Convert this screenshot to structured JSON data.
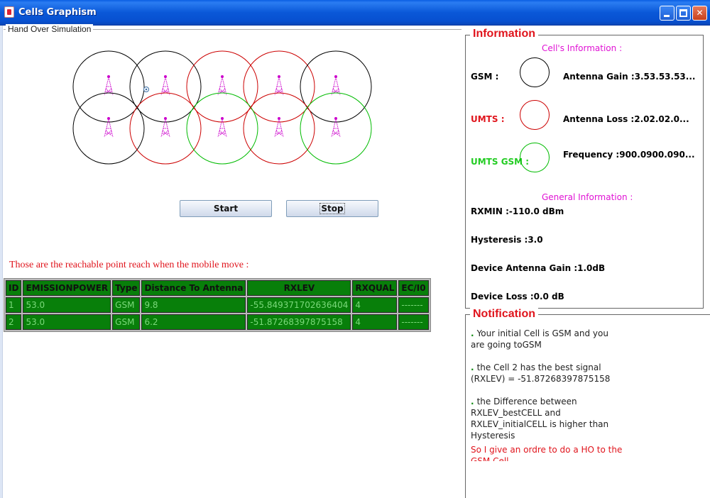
{
  "window": {
    "title": "Cells Graphism"
  },
  "simulation": {
    "panel_title": "Hand Over Simulation",
    "start_label": "Start",
    "stop_label": "Stop",
    "caption": "Those are the reachable point reach when the mobile move :"
  },
  "cells": {
    "colors": {
      "gsm": "#000000",
      "umts": "#cc0000",
      "umts_gsm": "#00bb00",
      "antenna": "#cc00cc",
      "mobile": "#3a6ea5"
    },
    "top_row": [
      "gsm",
      "gsm",
      "umts",
      "umts",
      "gsm"
    ],
    "bottom_row": [
      "gsm",
      "umts",
      "umts_gsm",
      "umts",
      "umts_gsm"
    ]
  },
  "table": {
    "headers": [
      "ID",
      "EMISSIONPOWER",
      "Type",
      "Distance To Antenna",
      "RXLEV",
      "RXQUAL",
      "EC/I0"
    ],
    "rows": [
      [
        "1",
        "53.0",
        "GSM",
        "9.8",
        "-55.849371702636404",
        "4",
        "-------"
      ],
      [
        "2",
        "53.0",
        "GSM",
        "6.2",
        "-51.87268397875158",
        "4",
        "-------"
      ]
    ]
  },
  "information": {
    "legend": "Information",
    "cells_heading": "Cell's Information :",
    "gsm_label": "GSM :",
    "umts_label": "UMTS :",
    "umts_gsm_label": "UMTS GSM :",
    "antenna_gain": "Antenna Gain :3.53.53.53...",
    "antenna_loss": "Antenna Loss :2.02.02.0...",
    "frequency": "Frequency :900.0900.090...",
    "general_heading": "General Information :",
    "rxmin": "RXMIN :-110.0 dBm",
    "hysteresis": "Hysteresis :3.0",
    "device_gain": "Device Antenna Gain :1.0dB",
    "device_loss": "Device Loss :0.0 dB"
  },
  "notification": {
    "legend": "Notification",
    "n1_line1": "Your initial Cell is GSM and you",
    "n1_line2": "are going toGSM",
    "n2_line1": "the Cell 2 has the best signal",
    "n2_line2": "(RXLEV) = -51.87268397875158",
    "n3_line1": "the Difference between",
    "n3_line2": "RXLEV_bestCELL and",
    "n3_line3": "RXLEV_initialCELL is higher than",
    "n3_line4": "Hysteresis",
    "n3_line5": "So I give an ordre to do a HO to the",
    "n3_line6": "GSM Cell"
  }
}
